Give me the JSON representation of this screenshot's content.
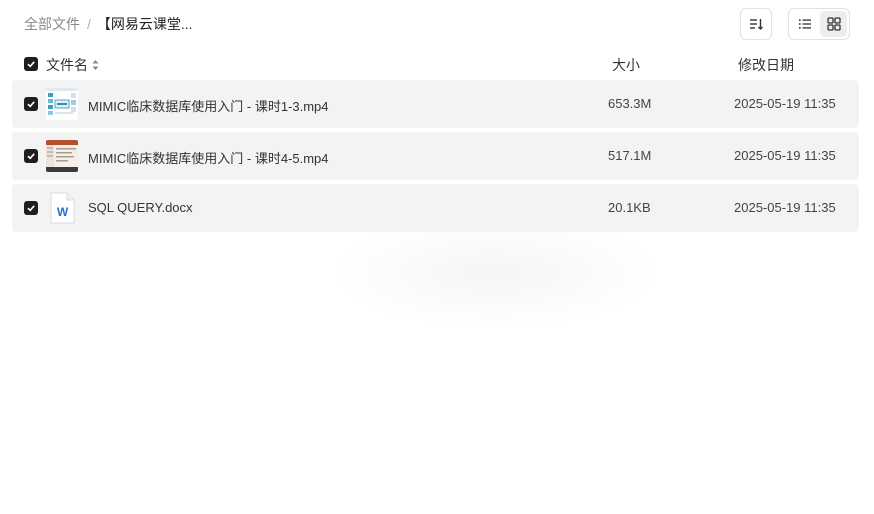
{
  "breadcrumb": {
    "root": "全部文件",
    "separator": "/",
    "current": "【网易云课堂..."
  },
  "toolbar": {
    "sort_icon": "sort-icon",
    "list_view_icon": "list-view-icon",
    "grid_view_icon": "grid-view-icon"
  },
  "table": {
    "columns": {
      "name": "文件名",
      "size": "大小",
      "modified": "修改日期"
    },
    "rows": [
      {
        "name": "MIMIC临床数据库使用入门 - 课时1-3.mp4",
        "size": "653.3M",
        "modified": "2025-05-19 11:35",
        "icon": "video-thumbnail"
      },
      {
        "name": "MIMIC临床数据库使用入门 - 课时4-5.mp4",
        "size": "517.1M",
        "modified": "2025-05-19 11:35",
        "icon": "video-thumbnail"
      },
      {
        "name": "SQL QUERY.docx",
        "size": "20.1KB",
        "modified": "2025-05-19 11:35",
        "icon": "word-doc-icon"
      }
    ]
  },
  "colors": {
    "row_bg": "#f3f3f3",
    "checkbox": "#1f1f1f",
    "word_blue": "#2b6fd6"
  }
}
